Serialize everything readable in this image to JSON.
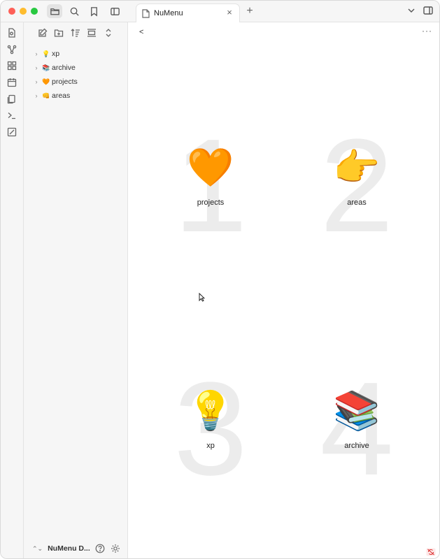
{
  "titlebar": {
    "icons": [
      "folder-icon",
      "search-icon",
      "bookmark-icon",
      "sidebar-toggle-icon"
    ]
  },
  "tab": {
    "title": "NuMenu",
    "close_glyph": "×",
    "new_glyph": "+"
  },
  "ribbon": {
    "icons": [
      "quick-switcher-icon",
      "graph-icon",
      "canvas-icon",
      "calendar-icon",
      "pages-icon",
      "terminal-icon",
      "slides-icon"
    ]
  },
  "sidebar": {
    "tools": [
      "new-note-icon",
      "new-folder-icon",
      "sort-icon",
      "collapse-icon",
      "expand-icon"
    ],
    "items": [
      {
        "label": "xp",
        "emoji": "💡"
      },
      {
        "label": "archive",
        "emoji": "📚"
      },
      {
        "label": "projects",
        "emoji": "🧡"
      },
      {
        "label": "areas",
        "emoji": "👊"
      }
    ],
    "vault_name": "NuMenu D..."
  },
  "main": {
    "back_label": "<",
    "more_label": "···",
    "tiles": [
      {
        "number": "1",
        "emoji": "🧡",
        "label": "projects"
      },
      {
        "number": "2",
        "emoji": "👉",
        "label": "areas"
      },
      {
        "number": "3",
        "emoji": "💡",
        "label": "xp"
      },
      {
        "number": "4",
        "emoji": "📚",
        "label": "archive"
      }
    ]
  },
  "colors": {
    "traffic_red": "#fe5f57",
    "traffic_yellow": "#febc2e",
    "traffic_green": "#28c840",
    "number_watermark": "#ececec",
    "sidebar_bg": "#f6f6f6"
  }
}
